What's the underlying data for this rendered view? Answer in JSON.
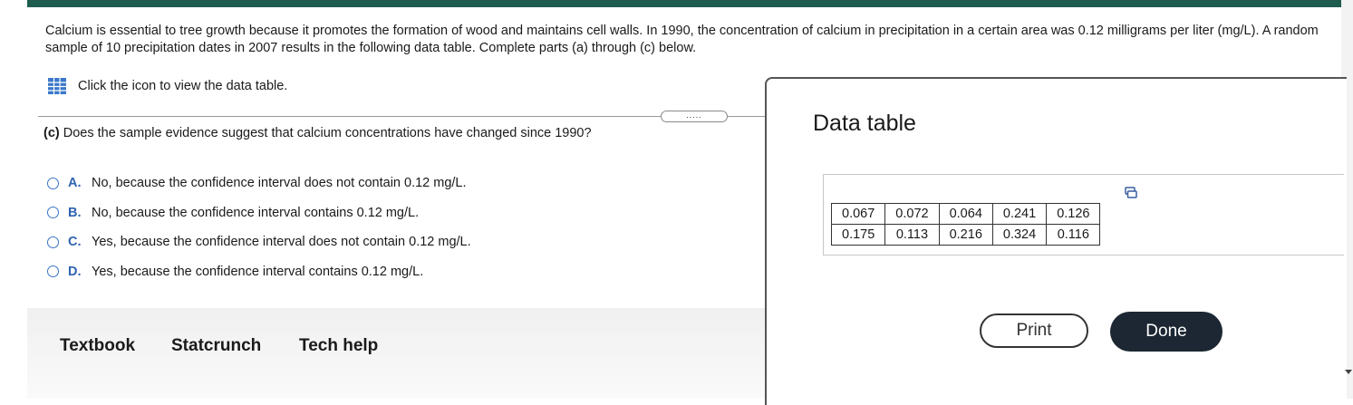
{
  "intro_text": "Calcium is essential to tree growth because it promotes the formation of wood and maintains cell walls. In 1990, the concentration of calcium in precipitation in a certain area was 0.12 milligrams per liter (mg/L). A random sample of 10 precipitation dates in 2007 results in the following data table. Complete parts (a) through (c) below.",
  "view_link": "Click the icon to view the data table.",
  "expand_handle": ".....",
  "question": {
    "part": "(c)",
    "text": "Does the sample evidence suggest that calcium concentrations have changed since 1990?"
  },
  "options": [
    {
      "letter": "A.",
      "text": "No, because the confidence interval does not contain 0.12 mg/L."
    },
    {
      "letter": "B.",
      "text": "No, because the confidence interval contains 0.12 mg/L."
    },
    {
      "letter": "C.",
      "text": "Yes, because the confidence interval does not contain 0.12 mg/L."
    },
    {
      "letter": "D.",
      "text": "Yes, because the confidence interval contains 0.12 mg/L."
    }
  ],
  "footer": {
    "textbook": "Textbook",
    "statcrunch": "Statcrunch",
    "tech_help": "Tech help"
  },
  "modal": {
    "title": "Data table",
    "rows": [
      [
        "0.067",
        "0.072",
        "0.064",
        "0.241",
        "0.126"
      ],
      [
        "0.175",
        "0.113",
        "0.216",
        "0.324",
        "0.116"
      ]
    ],
    "print_label": "Print",
    "done_label": "Done"
  },
  "colors": {
    "top_bar": "#1d5c4e",
    "option_letter": "#2f63b0",
    "done_button": "#1c2733"
  },
  "icons": [
    "table-grid-icon",
    "copy-icon",
    "scroll-down-icon"
  ]
}
